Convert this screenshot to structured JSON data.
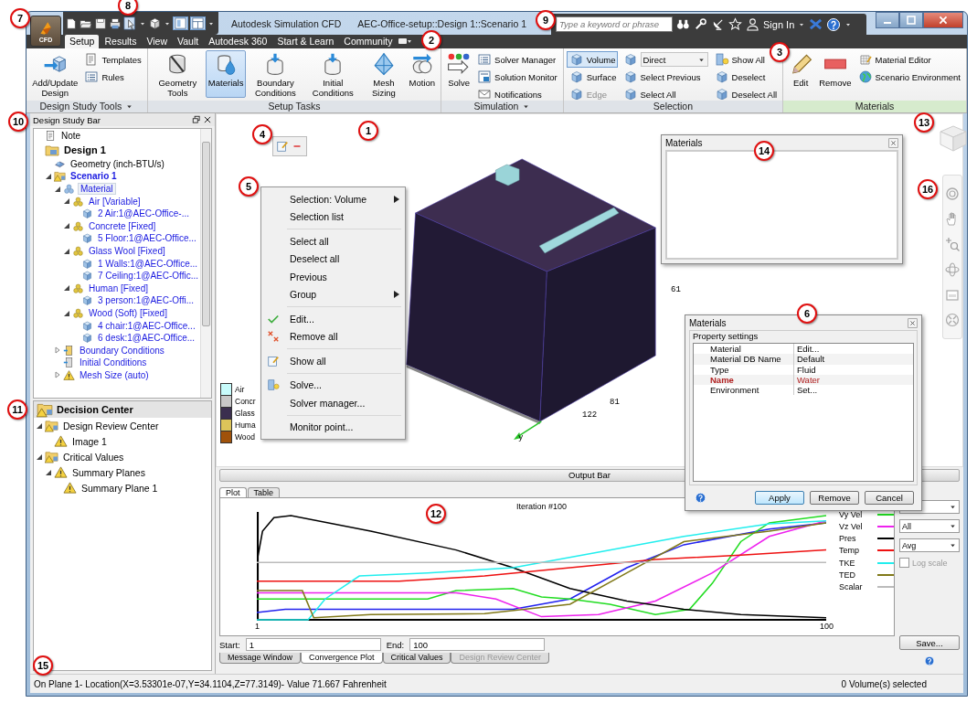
{
  "window": {
    "app_label": "CFD",
    "title": "Autodesk Simulation CFD",
    "document": "AEC-Office-setup::Design 1::Scenario 1"
  },
  "search": {
    "placeholder": "Type a keyword or phrase"
  },
  "account": {
    "label": "Sign In"
  },
  "tabs": [
    {
      "label": "Setup",
      "selected": true
    },
    {
      "label": "Results",
      "selected": false
    },
    {
      "label": "View",
      "selected": false
    },
    {
      "label": "Vault",
      "selected": false
    },
    {
      "label": "Autodesk 360",
      "selected": false
    },
    {
      "label": "Start & Learn",
      "selected": false
    },
    {
      "label": "Community",
      "selected": false
    }
  ],
  "ribbon": [
    {
      "title": "Design Study Tools",
      "menu": true,
      "contextual": false,
      "columns": [
        {
          "kind": "large",
          "label": "Add/Update Design",
          "selected": false
        },
        {
          "kind": "stack",
          "items": [
            {
              "label": "Templates"
            },
            {
              "label": "Rules"
            }
          ]
        }
      ]
    },
    {
      "title": "Setup Tasks",
      "menu": false,
      "contextual": false,
      "columns": [
        {
          "kind": "large",
          "label": "Geometry Tools",
          "selected": false
        },
        {
          "kind": "large",
          "label": "Materials",
          "selected": true
        },
        {
          "kind": "large",
          "label": "Boundary Conditions",
          "selected": false
        },
        {
          "kind": "large",
          "label": "Initial Conditions",
          "selected": false
        },
        {
          "kind": "large",
          "label": "Mesh Sizing",
          "selected": false
        },
        {
          "kind": "large",
          "label": "Motion",
          "selected": false
        }
      ]
    },
    {
      "title": "Simulation",
      "menu": true,
      "contextual": false,
      "columns": [
        {
          "kind": "large",
          "label": "Solve",
          "selected": false
        },
        {
          "kind": "stack",
          "items": [
            {
              "label": "Solver Manager"
            },
            {
              "label": "Solution Monitor"
            },
            {
              "label": "Notifications"
            }
          ]
        }
      ]
    },
    {
      "title": "Selection",
      "menu": false,
      "contextual": false,
      "columns": [
        {
          "kind": "toggles",
          "items": [
            {
              "label": "Volume",
              "selected": true,
              "disabled": false
            },
            {
              "label": "Surface",
              "selected": false,
              "disabled": false
            },
            {
              "label": "Edge",
              "selected": false,
              "disabled": true
            }
          ]
        },
        {
          "kind": "stack",
          "items": [
            {
              "label": "Direct",
              "kind": "dropdown"
            },
            {
              "label": "Select Previous"
            },
            {
              "label": "Select All"
            }
          ]
        },
        {
          "kind": "stack",
          "items": [
            {
              "label": "Show All"
            },
            {
              "label": "Deselect"
            },
            {
              "label": "Deselect All"
            }
          ]
        }
      ]
    },
    {
      "title": "Materials",
      "menu": false,
      "contextual": true,
      "columns": [
        {
          "kind": "large",
          "label": "Edit",
          "selected": false
        },
        {
          "kind": "large",
          "label": "Remove",
          "selected": false
        },
        {
          "kind": "stack",
          "items": [
            {
              "label": "Material Editor"
            },
            {
              "label": "Scenario Environment"
            }
          ]
        }
      ]
    }
  ],
  "design_study_bar": {
    "title": "Design Study Bar",
    "tree": [
      {
        "kind": "note",
        "label": "Note",
        "selected": false
      },
      {
        "kind": "design",
        "label": "Design 1",
        "selected": false,
        "children": [
          {
            "kind": "geometry",
            "label": "Geometry (inch-BTU/s)",
            "selected": false
          },
          {
            "kind": "scenario",
            "label": "Scenario 1",
            "selected": false,
            "expanded": true,
            "children": [
              {
                "kind": "material-root",
                "label": "Material",
                "selected": true,
                "expanded": true,
                "children": [
                  {
                    "kind": "material",
                    "label": "Air [Variable]",
                    "selected": false,
                    "expanded": true,
                    "children": [
                      {
                        "kind": "part",
                        "label": "2 Air:1@AEC-Office-...",
                        "selected": false
                      }
                    ]
                  },
                  {
                    "kind": "material",
                    "label": "Concrete [Fixed]",
                    "selected": false,
                    "expanded": true,
                    "children": [
                      {
                        "kind": "part",
                        "label": "5 Floor:1@AEC-Office...",
                        "selected": false
                      }
                    ]
                  },
                  {
                    "kind": "material",
                    "label": "Glass Wool [Fixed]",
                    "selected": false,
                    "expanded": true,
                    "children": [
                      {
                        "kind": "part",
                        "label": "1 Walls:1@AEC-Office...",
                        "selected": false
                      },
                      {
                        "kind": "part",
                        "label": "7 Ceiling:1@AEC-Offic...",
                        "selected": false
                      }
                    ]
                  },
                  {
                    "kind": "material",
                    "label": "Human [Fixed]",
                    "selected": false,
                    "expanded": true,
                    "children": [
                      {
                        "kind": "part",
                        "label": "3 person:1@AEC-Offi...",
                        "selected": false
                      }
                    ]
                  },
                  {
                    "kind": "material",
                    "label": "Wood (Soft) [Fixed]",
                    "selected": false,
                    "expanded": true,
                    "children": [
                      {
                        "kind": "part",
                        "label": "4 chair:1@AEC-Office...",
                        "selected": false
                      },
                      {
                        "kind": "part",
                        "label": "6 desk:1@AEC-Office...",
                        "selected": false
                      }
                    ]
                  }
                ]
              },
              {
                "kind": "boundary",
                "label": "Boundary Conditions",
                "selected": false,
                "expanded": false
              },
              {
                "kind": "initial",
                "label": "Initial Conditions",
                "selected": false
              },
              {
                "kind": "mesh",
                "label": "Mesh Size (auto)",
                "selected": false,
                "expanded": false
              }
            ]
          }
        ]
      }
    ]
  },
  "decision_center": {
    "title": "Decision Center",
    "tree": [
      {
        "label": "Design Review Center",
        "expanded": true,
        "children": [
          {
            "label": "Image 1"
          }
        ]
      },
      {
        "label": "Critical Values",
        "expanded": true,
        "children": [
          {
            "label": "Summary Planes",
            "expanded": true,
            "children": [
              {
                "label": "Summary Plane 1"
              }
            ]
          }
        ]
      }
    ]
  },
  "viewport": {
    "legend": [
      {
        "label": "Air",
        "color": "#c8fcfc"
      },
      {
        "label": "Concr",
        "color": "#c8c8c8"
      },
      {
        "label": "Glass",
        "color": "#3b2f4f"
      },
      {
        "label": "Huma",
        "color": "#dcc45a"
      },
      {
        "label": "Wood",
        "color": "#a0520a"
      }
    ],
    "axis_labels": [
      "61",
      "81",
      "122",
      "y"
    ],
    "context_menu": [
      [
        {
          "label": "Selection: Volume",
          "submenu": true
        },
        {
          "label": "Selection list",
          "submenu": false
        }
      ],
      [
        {
          "label": "Select all",
          "submenu": false
        },
        {
          "label": "Deselect all",
          "submenu": false
        },
        {
          "label": "Previous",
          "submenu": false
        },
        {
          "label": "Group",
          "submenu": true
        }
      ],
      [
        {
          "label": "Edit...",
          "submenu": false
        },
        {
          "label": "Remove all",
          "submenu": false
        }
      ],
      [
        {
          "label": "Show all",
          "submenu": false
        }
      ],
      [
        {
          "label": "Solve...",
          "submenu": false
        },
        {
          "label": "Solver manager...",
          "submenu": false
        }
      ],
      [
        {
          "label": "Monitor point...",
          "submenu": false
        }
      ]
    ]
  },
  "materials_panel": {
    "title": "Materials"
  },
  "materials_dialog": {
    "title": "Materials",
    "group": "Property settings",
    "rows": [
      {
        "name": "Material",
        "value": "Edit...",
        "highlighted": false
      },
      {
        "name": "Material DB Name",
        "value": "Default",
        "highlighted": false
      },
      {
        "name": "Type",
        "value": "Fluid",
        "highlighted": false
      },
      {
        "name": "Name",
        "value": "Water",
        "highlighted": true
      },
      {
        "name": "Environment",
        "value": "Set...",
        "highlighted": false
      }
    ],
    "buttons": [
      {
        "label": "Apply",
        "default": true
      },
      {
        "label": "Remove",
        "default": false
      },
      {
        "label": "Cancel",
        "default": false
      }
    ]
  },
  "output_bar": {
    "title": "Output Bar",
    "tabs": [
      {
        "label": "Plot",
        "selected": true
      },
      {
        "label": "Table",
        "selected": false
      }
    ],
    "plot_title": "Iteration #100",
    "x_start": "1",
    "x_end": "100",
    "legend": [
      {
        "label": "Vy Vel",
        "color": "#22dd22"
      },
      {
        "label": "Vz Vel",
        "color": "#ee22ee"
      },
      {
        "label": "Pres",
        "color": "#000000"
      },
      {
        "label": "Temp",
        "color": "#ee1111"
      },
      {
        "label": "TKE",
        "color": "#22eeee"
      },
      {
        "label": "TED",
        "color": "#807818"
      },
      {
        "label": "Scalar",
        "color": "#bbbbbb"
      }
    ],
    "selectors": [
      {
        "value": "All"
      },
      {
        "value": "Avg"
      }
    ],
    "log_scale": {
      "label": "Log scale",
      "checked": false,
      "disabled": true
    },
    "save_button": "Save...",
    "start": {
      "label": "Start:",
      "value": "1"
    },
    "end": {
      "label": "End:",
      "value": "100"
    },
    "bottom_tabs": [
      {
        "label": "Message Window",
        "selected": false,
        "disabled": false
      },
      {
        "label": "Convergence Plot",
        "selected": true,
        "disabled": false
      },
      {
        "label": "Critical Values",
        "selected": false,
        "disabled": false
      },
      {
        "label": "Design Review Center",
        "selected": false,
        "disabled": true
      }
    ]
  },
  "status_bar": {
    "location": "On Plane 1- Location(X=3.53301e-07,Y=34.1104,Z=77.3149)- Value 71.667 Fahrenheit",
    "selection": "0 Volume(s) selected"
  },
  "callouts": [
    "7",
    "8",
    "9",
    "2",
    "3",
    "10",
    "4",
    "1",
    "13",
    "14",
    "5",
    "16",
    "6",
    "11",
    "12",
    "15"
  ]
}
